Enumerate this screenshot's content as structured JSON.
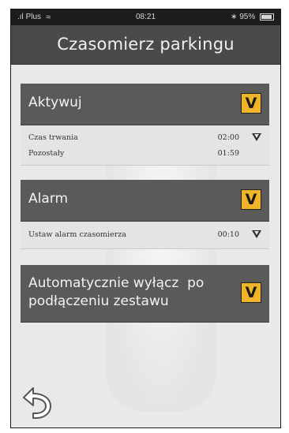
{
  "statusbar": {
    "carrier": "Plus",
    "time": "08:21",
    "battery_percent": "95%"
  },
  "header": {
    "title": "Czasomierz parkingu"
  },
  "sections": {
    "activate": {
      "title": "Aktywuj",
      "checked": true,
      "check_glyph": "V",
      "duration_label": "Czas trwania",
      "duration_value": "02:00",
      "remaining_label": "Pozostały",
      "remaining_value": "01:59"
    },
    "alarm": {
      "title": "Alarm",
      "checked": true,
      "check_glyph": "V",
      "set_label": "Ustaw alarm czasomierza",
      "set_value": "00:10"
    },
    "auto_off": {
      "title_line1": "Automatycznie wyłącz  po",
      "title_line2": "podłączeniu zestawu",
      "checked": true,
      "check_glyph": "V"
    }
  },
  "colors": {
    "accent": "#f0b428",
    "header_bg": "#4a4a4a",
    "section_bg": "#5a5a5a"
  },
  "icons": {
    "back": "back-arrow-icon",
    "dropdown": "triangle-down-icon",
    "wifi": "wifi-icon",
    "bluetooth": "bluetooth-icon",
    "battery": "battery-icon"
  }
}
